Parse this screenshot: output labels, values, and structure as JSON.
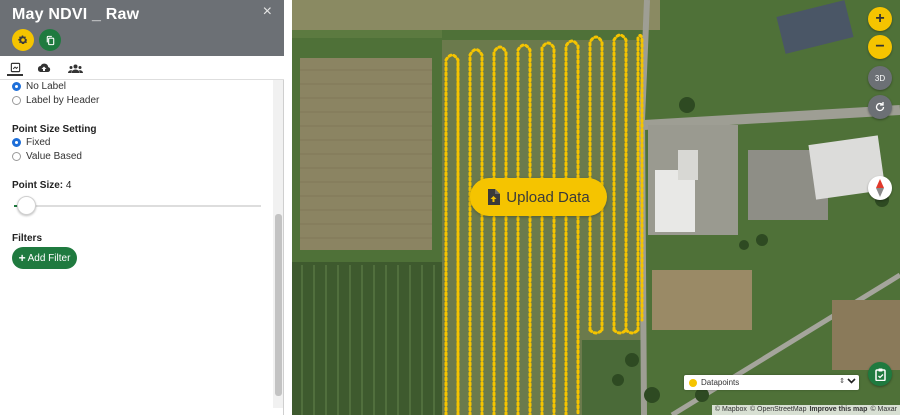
{
  "sidebar": {
    "title": "May NDVI _ Raw",
    "close_symbol": "×",
    "header_buttons": [
      {
        "name": "settings",
        "icon": "gear-icon"
      },
      {
        "name": "copy",
        "icon": "copy-icon"
      }
    ],
    "tabs": [
      {
        "name": "layers",
        "icon": "layers-icon",
        "active": true
      },
      {
        "name": "cloud",
        "icon": "cloud-upload-icon",
        "active": false
      },
      {
        "name": "sharing",
        "icon": "users-icon",
        "active": false
      }
    ],
    "label_options": [
      {
        "label": "No Label",
        "checked": true
      },
      {
        "label": "Label by Header",
        "checked": false
      }
    ],
    "point_size_setting": {
      "heading": "Point Size Setting",
      "options": [
        {
          "label": "Fixed",
          "checked": true
        },
        {
          "label": "Value Based",
          "checked": false
        }
      ]
    },
    "point_size": {
      "label": "Point Size:",
      "value": "4"
    },
    "filters": {
      "heading": "Filters",
      "add_button": "Add Filter",
      "add_symbol": "+"
    }
  },
  "map": {
    "upload_label": "Upload Data",
    "controls": {
      "zoom_in": "+",
      "zoom_out": "−",
      "three_d": "3D"
    },
    "layer_select": {
      "label": "Datapoints",
      "arrows": "⇕"
    },
    "attribution": {
      "mapbox": "© Mapbox",
      "osm": "© OpenStreetMap",
      "improve": "Improve this map",
      "maxar": "© Maxar"
    }
  },
  "colors": {
    "accent": "#f5c400",
    "primary": "#1f7a3f",
    "header": "#6c7075",
    "radio": "#1e6fd9"
  }
}
